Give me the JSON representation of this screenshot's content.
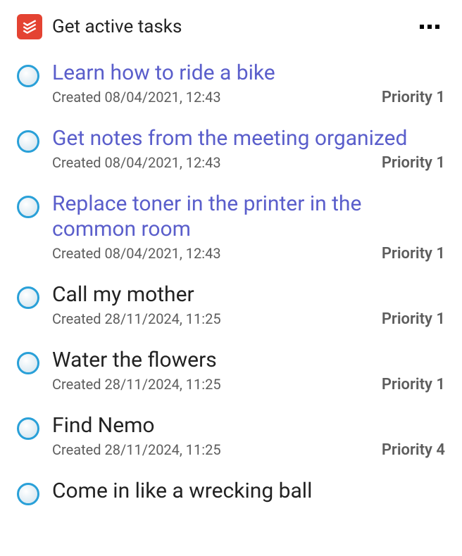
{
  "header": {
    "title": "Get active tasks",
    "app_icon_name": "todoist-icon"
  },
  "tasks": [
    {
      "title": "Learn how to ride a bike",
      "created_label": "Created 08/04/2021, 12:43",
      "priority": "Priority 1",
      "is_link": true
    },
    {
      "title": "Get notes from the meeting organized",
      "created_label": "Created 08/04/2021, 12:43",
      "priority": "Priority 1",
      "is_link": true
    },
    {
      "title": "Replace toner in the printer in the common room",
      "created_label": "Created 08/04/2021, 12:43",
      "priority": "Priority 1",
      "is_link": true
    },
    {
      "title": "Call my mother",
      "created_label": "Created 28/11/2024, 11:25",
      "priority": "Priority 1",
      "is_link": false
    },
    {
      "title": "Water the flowers",
      "created_label": "Created 28/11/2024, 11:25",
      "priority": "Priority 1",
      "is_link": false
    },
    {
      "title": "Find Nemo",
      "created_label": "Created 28/11/2024, 11:25",
      "priority": "Priority 4",
      "is_link": false
    },
    {
      "title": "Come in like a wrecking ball",
      "created_label": "",
      "priority": "",
      "is_link": false
    }
  ]
}
